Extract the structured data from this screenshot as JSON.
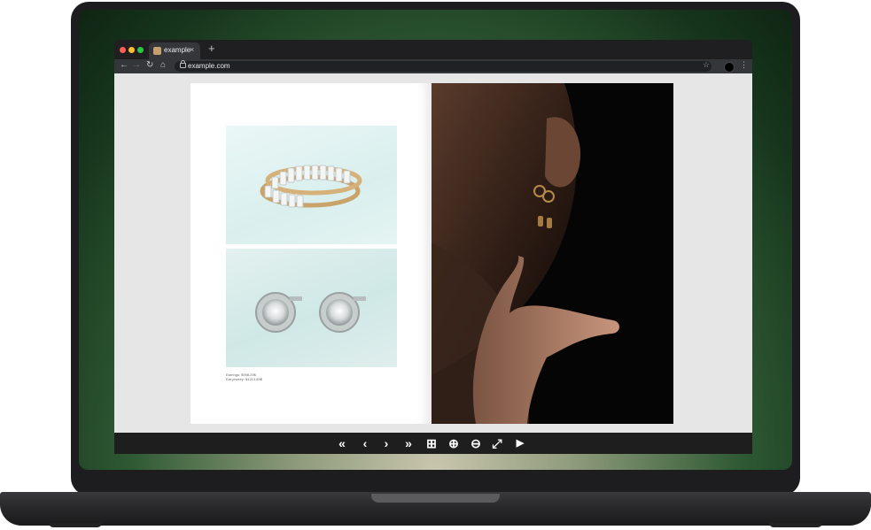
{
  "browser": {
    "tab_title": "example",
    "tab_close": "×",
    "new_tab": "+",
    "url": "example.com",
    "traffic_lights": [
      "#ff5f57",
      "#febc2e",
      "#28c840"
    ]
  },
  "toolbar": {
    "back": "←",
    "forward": "→",
    "reload": "↻",
    "home": "⌂",
    "star": "☆",
    "menu": "⋮"
  },
  "flipbook": {
    "left_page": {
      "caption_line1": "Earrings: $998,29$",
      "caption_line2": "Ear jewelry: $1213,89$"
    },
    "controls": [
      {
        "name": "first-page",
        "glyph": "«"
      },
      {
        "name": "previous-page",
        "glyph": "‹"
      },
      {
        "name": "next-page",
        "glyph": "›"
      },
      {
        "name": "last-page",
        "glyph": "»"
      },
      {
        "name": "thumbnails",
        "glyph": "⊞"
      },
      {
        "name": "zoom-in",
        "glyph": "⊕"
      },
      {
        "name": "zoom-out",
        "glyph": "⊖"
      },
      {
        "name": "fullscreen",
        "glyph": "⤢"
      },
      {
        "name": "autoplay",
        "glyph": "▶"
      }
    ]
  }
}
